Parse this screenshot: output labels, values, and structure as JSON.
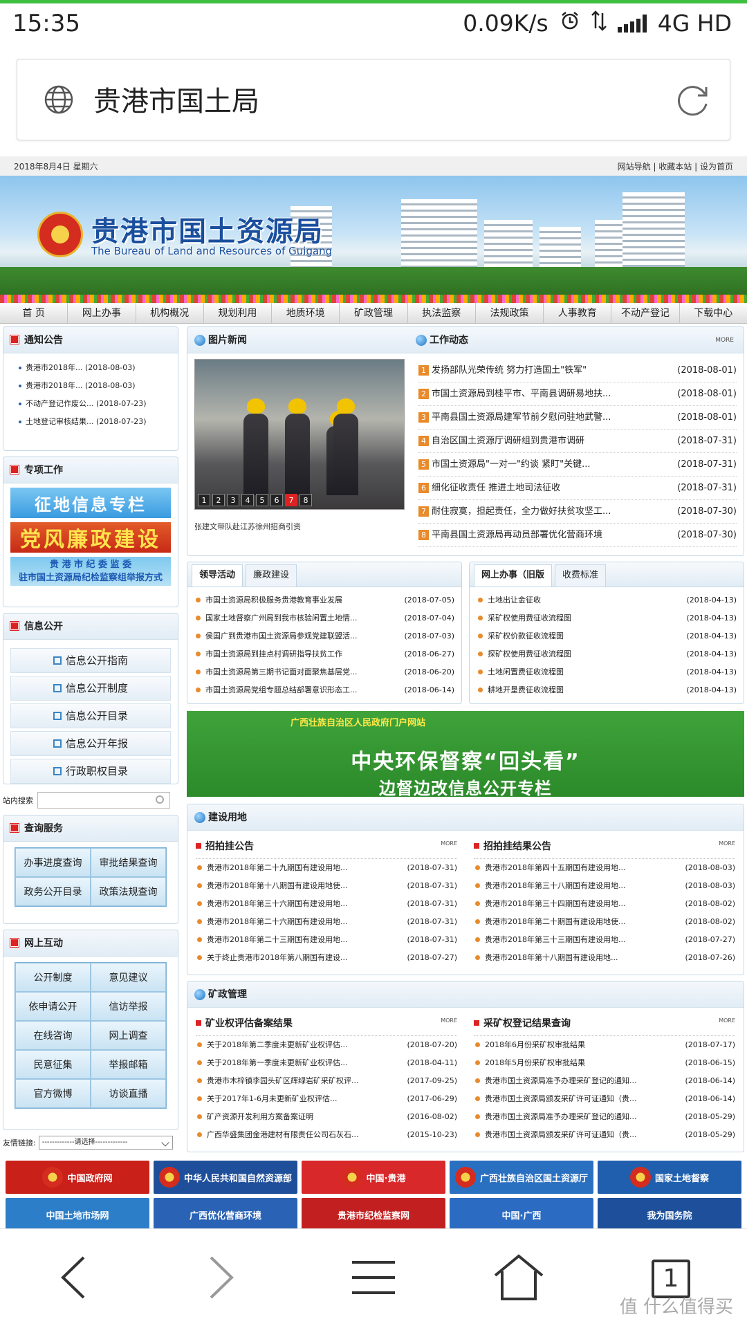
{
  "status": {
    "time": "15:35",
    "speed": "0.09K/s",
    "network": "4G HD"
  },
  "urlbar": {
    "title": "贵港市国土局"
  },
  "topline": {
    "date": "2018年8月4日 星期六",
    "links": [
      "网站导航",
      "收藏本站",
      "设为首页"
    ]
  },
  "banner": {
    "name": "贵港市国土资源局",
    "english": "The Bureau of Land and Resources of Guigang"
  },
  "nav": [
    "首 页",
    "网上办事",
    "机构概况",
    "规划利用",
    "地质环境",
    "矿政管理",
    "执法监察",
    "法规政策",
    "人事教育",
    "不动产登记",
    "下载中心"
  ],
  "notice": {
    "title": "通知公告",
    "items": [
      {
        "text": "贵港市2018年...",
        "date": "(2018-08-03)"
      },
      {
        "text": "贵港市2018年...",
        "date": "(2018-08-03)"
      },
      {
        "text": "不动产登记作废公...",
        "date": "(2018-07-23)"
      },
      {
        "text": "土地登记审核结果...",
        "date": "(2018-07-23)"
      }
    ]
  },
  "special": {
    "title": "专项工作",
    "promo1": "征地信息专栏",
    "promo2": "党风廉政建设",
    "promo3a": "贵 港 市 纪 委 监 委",
    "promo3b": "驻市国土资源局纪检监察组举报方式"
  },
  "info": {
    "title": "信息公开",
    "items": [
      "信息公开指南",
      "信息公开制度",
      "信息公开目录",
      "信息公开年报",
      "行政职权目录"
    ]
  },
  "search": {
    "label": "站内搜索"
  },
  "query": {
    "title": "查询服务",
    "items": [
      "办事进度查询",
      "审批结果查询",
      "政务公开目录",
      "政策法规查询"
    ]
  },
  "interact": {
    "title": "网上互动",
    "items": [
      "公开制度",
      "意见建议",
      "依申请公开",
      "信访举报",
      "在线咨询",
      "网上调查",
      "民意征集",
      "举报邮箱",
      "官方微博",
      "访谈直播"
    ]
  },
  "friends": {
    "label": "友情链接:",
    "select": "-------------请选择-------------"
  },
  "photonews": {
    "title": "图片新闻",
    "caption": "张建文带队赴江苏徐州招商引资",
    "nums": [
      "1",
      "2",
      "3",
      "4",
      "5",
      "6",
      "7",
      "8"
    ],
    "active": 7
  },
  "work": {
    "title": "工作动态",
    "more": "MORE",
    "items": [
      {
        "n": "1",
        "text": "发扬部队光荣传统 努力打造国土\"铁军\"",
        "date": "(2018-08-01)"
      },
      {
        "n": "2",
        "text": "市国土资源局到桂平市、平南县调研易地扶...",
        "date": "(2018-08-01)"
      },
      {
        "n": "3",
        "text": "平南县国土资源局建军节前夕慰问驻地武警...",
        "date": "(2018-08-01)"
      },
      {
        "n": "4",
        "text": "自治区国土资源厅调研组到贵港市调研",
        "date": "(2018-07-31)"
      },
      {
        "n": "5",
        "text": "市国土资源局\"一对一\"约谈 紧盯\"关键...",
        "date": "(2018-07-31)"
      },
      {
        "n": "6",
        "text": "细化征收责任 推进土地司法征收",
        "date": "(2018-07-31)"
      },
      {
        "n": "7",
        "text": "耐住寂寞，担起责任，全力做好扶贫攻坚工...",
        "date": "(2018-07-30)"
      },
      {
        "n": "8",
        "text": "平南县国土资源局再动员部署优化营商环境",
        "date": "(2018-07-30)"
      }
    ]
  },
  "leader": {
    "tabs": [
      "领导活动",
      "廉政建设"
    ],
    "items": [
      {
        "text": "市国土资源局积极服务贵港教育事业发展",
        "date": "(2018-07-05)"
      },
      {
        "text": "国家土地督察广州局到我市核验闲置土地情...",
        "date": "(2018-07-04)"
      },
      {
        "text": "侯国广到贵港市国土资源局参观党建联盟活...",
        "date": "(2018-07-03)"
      },
      {
        "text": "市国土资源局到挂点村调研指导扶贫工作",
        "date": "(2018-06-27)"
      },
      {
        "text": "市国土资源局第三期书记面对面聚焦基层党...",
        "date": "(2018-06-20)"
      },
      {
        "text": "市国土资源局党组专题总结部署意识形态工...",
        "date": "(2018-06-14)"
      }
    ]
  },
  "online": {
    "tabs": [
      "网上办事（旧版",
      "收费标准"
    ],
    "items": [
      {
        "text": "土地出让金征收",
        "date": "(2018-04-13)"
      },
      {
        "text": "采矿权使用费征收流程图",
        "date": "(2018-04-13)"
      },
      {
        "text": "采矿权价款征收流程图",
        "date": "(2018-04-13)"
      },
      {
        "text": "探矿权使用费征收流程图",
        "date": "(2018-04-13)"
      },
      {
        "text": "土地闲置费征收流程图",
        "date": "(2018-04-13)"
      },
      {
        "text": "耕地开垦费征收流程图",
        "date": "(2018-04-13)"
      }
    ]
  },
  "ad": {
    "top": "广西壮族自治区人民政府门户网站",
    "line1": "中央环保督察“回头看”",
    "line2": "边督边改信息公开专栏"
  },
  "construction": {
    "title": "建设用地",
    "left": {
      "title": "招拍挂公告",
      "more": "MORE",
      "items": [
        {
          "text": "贵港市2018年第二十九期国有建设用地...",
          "date": "(2018-07-31)"
        },
        {
          "text": "贵港市2018年第十八期国有建设用地使...",
          "date": "(2018-07-31)"
        },
        {
          "text": "贵港市2018年第三十六期国有建设用地...",
          "date": "(2018-07-31)"
        },
        {
          "text": "贵港市2018年第二十六期国有建设用地...",
          "date": "(2018-07-31)"
        },
        {
          "text": "贵港市2018年第二十三期国有建设用地...",
          "date": "(2018-07-31)"
        },
        {
          "text": "关于终止贵港市2018年第八期国有建设...",
          "date": "(2018-07-27)"
        }
      ]
    },
    "right": {
      "title": "招拍挂结果公告",
      "more": "MORE",
      "items": [
        {
          "text": "贵港市2018年第四十五期国有建设用地...",
          "date": "(2018-08-03)"
        },
        {
          "text": "贵港市2018年第三十八期国有建设用地...",
          "date": "(2018-08-03)"
        },
        {
          "text": "贵港市2018年第三十四期国有建设用地...",
          "date": "(2018-08-02)"
        },
        {
          "text": "贵港市2018年第二十期国有建设用地使...",
          "date": "(2018-08-02)"
        },
        {
          "text": "贵港市2018年第三十三期国有建设用地...",
          "date": "(2018-07-27)"
        },
        {
          "text": "贵港市2018年第十八期国有建设用地...",
          "date": "(2018-07-26)"
        }
      ]
    }
  },
  "mining": {
    "title": "矿政管理",
    "left": {
      "title": "矿业权评估备案结果",
      "more": "MORE",
      "items": [
        {
          "text": "关于2018年第二季度未更新矿业权评估...",
          "date": "(2018-07-20)"
        },
        {
          "text": "关于2018年第一季度未更新矿业权评估...",
          "date": "(2018-04-11)"
        },
        {
          "text": "贵港市木梓镇李园头矿区辉绿岩矿采矿权评...",
          "date": "(2017-09-25)"
        },
        {
          "text": "关于2017年1-6月未更新矿业权评估...",
          "date": "(2017-06-29)"
        },
        {
          "text": "矿产资源开发利用方案备案证明",
          "date": "(2016-08-02)"
        },
        {
          "text": "广西华盛集团金港建材有限责任公司石灰石...",
          "date": "(2015-10-23)"
        }
      ]
    },
    "right": {
      "title": "采矿权登记结果查询",
      "more": "MORE",
      "items": [
        {
          "text": "2018年6月份采矿权审批结果",
          "date": "(2018-07-17)"
        },
        {
          "text": "2018年5月份采矿权审批结果",
          "date": "(2018-06-15)"
        },
        {
          "text": "贵港市国土资源局准予办理采矿登记的通知...",
          "date": "(2018-06-14)"
        },
        {
          "text": "贵港市国土资源局颁发采矿许可证通知（贵...",
          "date": "(2018-06-14)"
        },
        {
          "text": "贵港市国土资源局准予办理采矿登记的通知...",
          "date": "(2018-05-29)"
        },
        {
          "text": "贵港市国土资源局颁发采矿许可证通知（贵...",
          "date": "(2018-05-29)"
        }
      ]
    }
  },
  "links": [
    {
      "label": "中国政府网",
      "color": "#c9201a"
    },
    {
      "label": "中华人民共和国自然资源部",
      "color": "#1f4f9a"
    },
    {
      "label": "中国·贵港",
      "color": "#d9282a"
    },
    {
      "label": "广西壮族自治区国土资源厅",
      "color": "#2a70c1"
    },
    {
      "label": "国家土地督察",
      "color": "#1f5fae"
    }
  ],
  "links2": [
    {
      "label": "中国土地市场网",
      "color": "#2d7ec8"
    },
    {
      "label": "广西优化营商环境",
      "color": "#2a63b5"
    },
    {
      "label": "贵港市纪检监察网",
      "color": "#c22020"
    },
    {
      "label": "中国·广西",
      "color": "#2c6bc2"
    },
    {
      "label": "我为国务院",
      "color": "#1d4f9a"
    }
  ],
  "bottom": {
    "tabs": "1",
    "watermark": "值 什么值得买"
  }
}
